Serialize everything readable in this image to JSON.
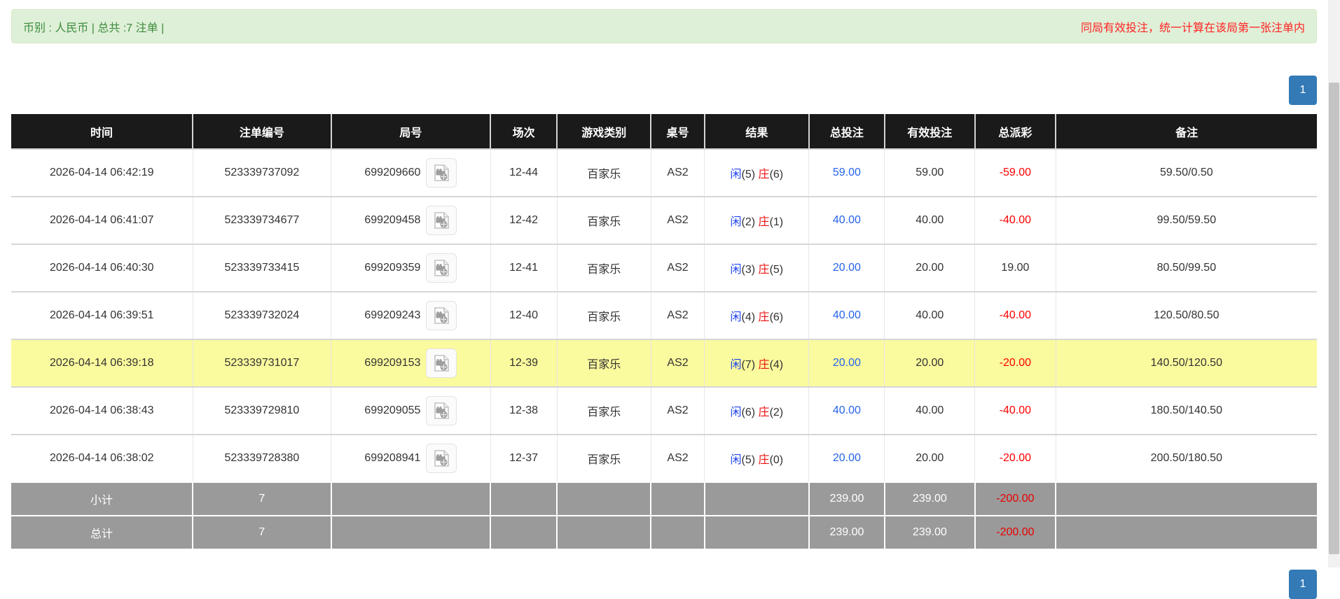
{
  "info_bar": {
    "left": "币别 : 人民币 | 总共 :7 注单 |",
    "right": "同局有效投注，统一计算在该局第一张注单内"
  },
  "pagination": {
    "label": "1"
  },
  "colors": {
    "accent_blue": "#337ab7",
    "link_blue": "#2563eb",
    "player_blue": "#2244ee",
    "banker_red": "#ee1111",
    "negative_red": "#ff0000",
    "success_bg": "#dff0d8",
    "success_text": "#3c8c3c",
    "notice_red": "#ff2222",
    "header_bg": "#1a1a1a",
    "summary_gray": "#9a9a9a",
    "highlight_yellow": "#fafa9e"
  },
  "table": {
    "columns": [
      "时间",
      "注单编号",
      "局号",
      "场次",
      "游戏类别",
      "桌号",
      "结果",
      "总投注",
      "有效投注",
      "总派彩",
      "备注"
    ],
    "column_widths": [
      "13.9%",
      "10.6%",
      "12.2%",
      "5.1%",
      "7.2%",
      "4.1%",
      "8.0%",
      "5.8%",
      "6.9%",
      "6.2%",
      "20.0%"
    ],
    "video_icon": "video-replay-icon",
    "rows": [
      {
        "time": "2026-04-14 06:42:19",
        "bet_id": "523339737092",
        "round_id": "699209660",
        "session": "12-44",
        "game_type": "百家乐",
        "table_no": "AS2",
        "result": {
          "player": "闲",
          "player_score": "(5)",
          "banker": "庄",
          "banker_score": "(6)"
        },
        "total_bet": "59.00",
        "valid_bet": "59.00",
        "payout": "-59.00",
        "remark": "59.50/0.50",
        "highlight": false
      },
      {
        "time": "2026-04-14 06:41:07",
        "bet_id": "523339734677",
        "round_id": "699209458",
        "session": "12-42",
        "game_type": "百家乐",
        "table_no": "AS2",
        "result": {
          "player": "闲",
          "player_score": "(2)",
          "banker": "庄",
          "banker_score": "(1)"
        },
        "total_bet": "40.00",
        "valid_bet": "40.00",
        "payout": "-40.00",
        "remark": "99.50/59.50",
        "highlight": false
      },
      {
        "time": "2026-04-14 06:40:30",
        "bet_id": "523339733415",
        "round_id": "699209359",
        "session": "12-41",
        "game_type": "百家乐",
        "table_no": "AS2",
        "result": {
          "player": "闲",
          "player_score": "(3)",
          "banker": "庄",
          "banker_score": "(5)"
        },
        "total_bet": "20.00",
        "valid_bet": "20.00",
        "payout": "19.00",
        "remark": "80.50/99.50",
        "highlight": false
      },
      {
        "time": "2026-04-14 06:39:51",
        "bet_id": "523339732024",
        "round_id": "699209243",
        "session": "12-40",
        "game_type": "百家乐",
        "table_no": "AS2",
        "result": {
          "player": "闲",
          "player_score": "(4)",
          "banker": "庄",
          "banker_score": "(6)"
        },
        "total_bet": "40.00",
        "valid_bet": "40.00",
        "payout": "-40.00",
        "remark": "120.50/80.50",
        "highlight": false
      },
      {
        "time": "2026-04-14 06:39:18",
        "bet_id": "523339731017",
        "round_id": "699209153",
        "session": "12-39",
        "game_type": "百家乐",
        "table_no": "AS2",
        "result": {
          "player": "闲",
          "player_score": "(7)",
          "banker": "庄",
          "banker_score": "(4)"
        },
        "total_bet": "20.00",
        "valid_bet": "20.00",
        "payout": "-20.00",
        "remark": "140.50/120.50",
        "highlight": true
      },
      {
        "time": "2026-04-14 06:38:43",
        "bet_id": "523339729810",
        "round_id": "699209055",
        "session": "12-38",
        "game_type": "百家乐",
        "table_no": "AS2",
        "result": {
          "player": "闲",
          "player_score": "(6)",
          "banker": "庄",
          "banker_score": "(2)"
        },
        "total_bet": "40.00",
        "valid_bet": "40.00",
        "payout": "-40.00",
        "remark": "180.50/140.50",
        "highlight": false
      },
      {
        "time": "2026-04-14 06:38:02",
        "bet_id": "523339728380",
        "round_id": "699208941",
        "session": "12-37",
        "game_type": "百家乐",
        "table_no": "AS2",
        "result": {
          "player": "闲",
          "player_score": "(5)",
          "banker": "庄",
          "banker_score": "(0)"
        },
        "total_bet": "20.00",
        "valid_bet": "20.00",
        "payout": "-20.00",
        "remark": "200.50/180.50",
        "highlight": false
      }
    ],
    "subtotal": {
      "label": "小计",
      "count": "7",
      "total_bet": "239.00",
      "valid_bet": "239.00",
      "payout": "-200.00"
    },
    "total": {
      "label": "总计",
      "count": "7",
      "total_bet": "239.00",
      "valid_bet": "239.00",
      "payout": "-200.00"
    }
  }
}
